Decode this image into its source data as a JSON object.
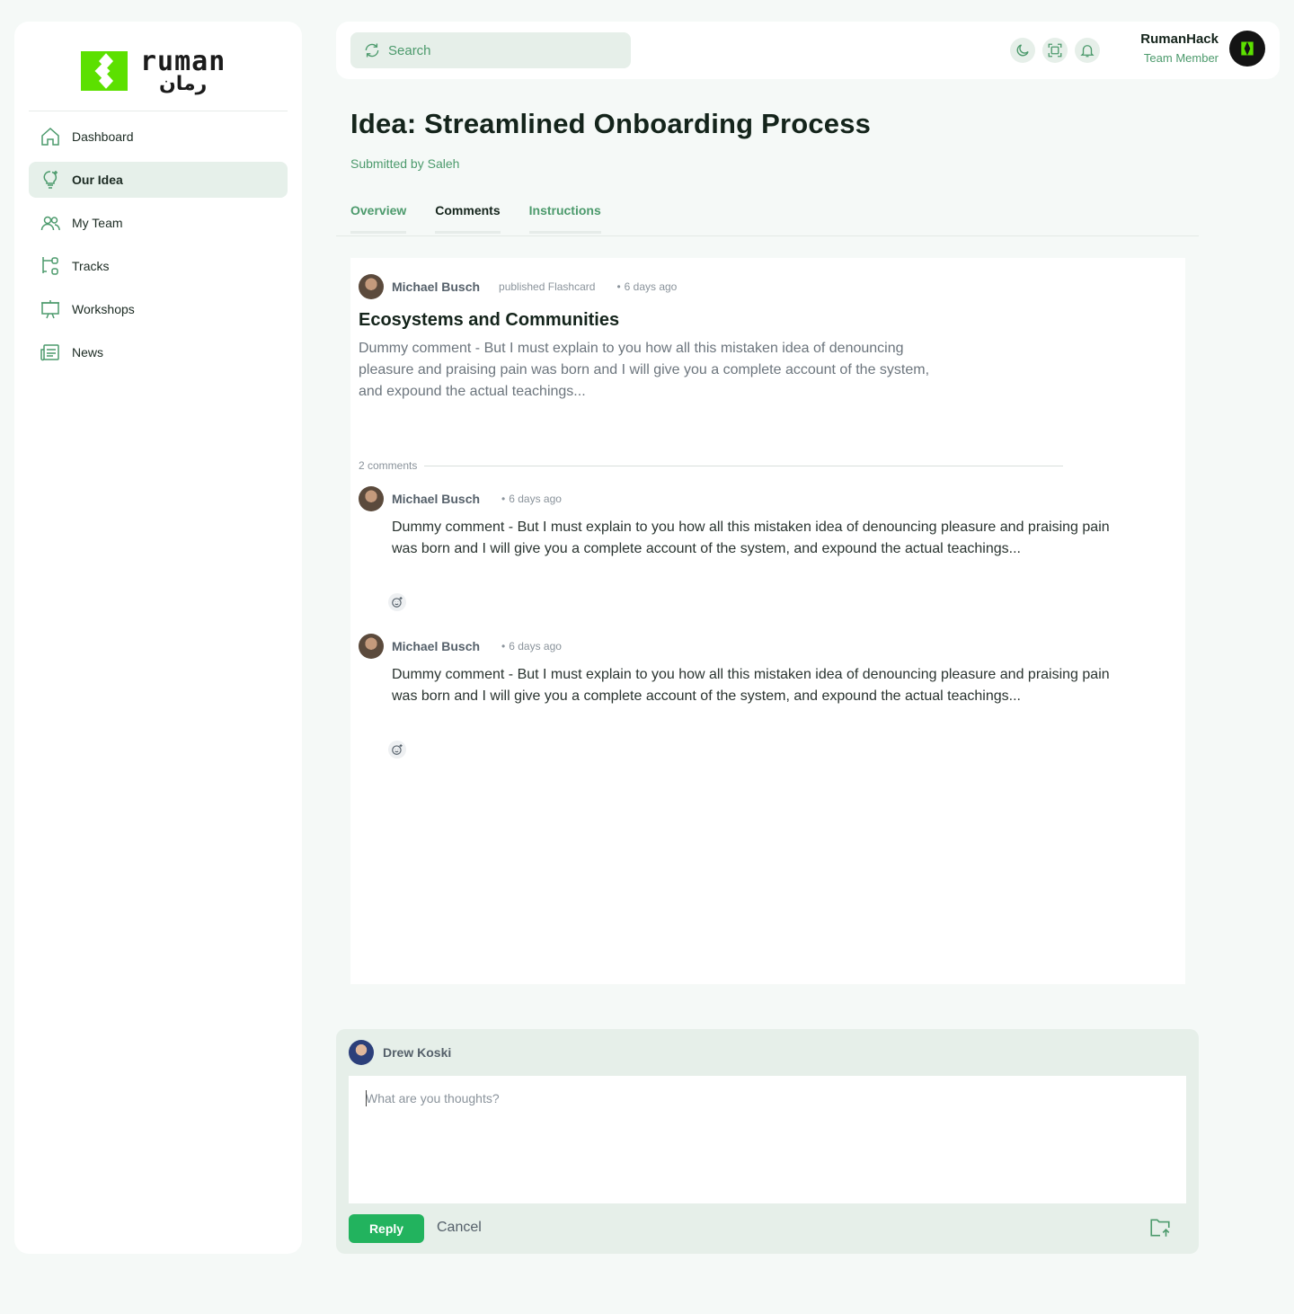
{
  "brand": {
    "latin": "ruman",
    "arabic": "رمان",
    "accent": "#5ce000",
    "primary": "#22b35e",
    "muted_green": "#4c9a6c"
  },
  "sidebar": {
    "items": [
      {
        "label": "Dashboard",
        "icon": "home-icon"
      },
      {
        "label": "Our Idea",
        "icon": "lightbulb-icon",
        "active": true
      },
      {
        "label": "My Team",
        "icon": "users-icon"
      },
      {
        "label": "Tracks",
        "icon": "tracks-icon"
      },
      {
        "label": "Workshops",
        "icon": "presentation-icon"
      },
      {
        "label": "News",
        "icon": "newspaper-icon"
      }
    ]
  },
  "topbar": {
    "search_placeholder": "Search",
    "icons": [
      "moon-icon",
      "scan-icon",
      "bell-icon"
    ],
    "user_name": "RumanHack",
    "user_role": "Team Member"
  },
  "page": {
    "title": "Idea: Streamlined Onboarding Process",
    "submitted_by": "Submitted by Saleh",
    "tabs": [
      {
        "label": "Overview"
      },
      {
        "label": "Comments",
        "active": true
      },
      {
        "label": "Instructions"
      }
    ]
  },
  "post": {
    "author": "Michael Busch",
    "action": "published Flashcard",
    "dot": "•",
    "time": "6 days ago",
    "title": "Ecosystems and Communities",
    "body": "Dummy comment - But I must explain to you how all this mistaken idea of denouncing pleasure and praising pain was born and I will give you a complete account of the system, and expound the actual teachings...",
    "comments_count": "2 comments",
    "comments": [
      {
        "author": "Michael Busch",
        "dot": "•",
        "time": "6 days ago",
        "text": "Dummy comment - But I must explain to you how all this mistaken idea of denouncing pleasure and praising pain was born and I will give you a complete account of the system, and expound the actual teachings..."
      },
      {
        "author": "Michael Busch",
        "dot": "•",
        "time": "6 days ago",
        "text": "Dummy comment - But I must explain to you how all this mistaken idea of denouncing pleasure and praising pain was born and I will give you a complete account of the system, and expound the actual teachings..."
      }
    ]
  },
  "reply": {
    "user": "Drew Koski",
    "placeholder": "What are you thoughts?",
    "reply_label": "Reply",
    "cancel_label": "Cancel"
  }
}
